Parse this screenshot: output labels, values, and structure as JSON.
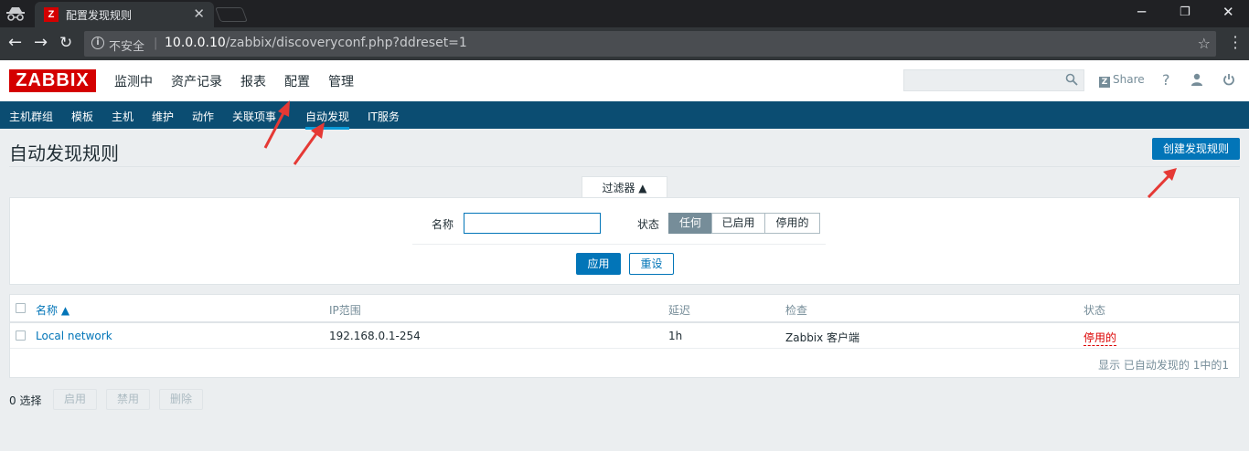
{
  "browser": {
    "tab_title": "配置发现规则",
    "tab_favicon": "Z",
    "security_label": "不安全",
    "url_host": "10.0.0.10",
    "url_path": "/zabbix/discoveryconf.php?ddreset=1"
  },
  "header": {
    "logo": "ZABBIX",
    "menu": [
      "监测中",
      "资产记录",
      "报表",
      "配置",
      "管理"
    ],
    "active_menu": "配置",
    "share_label": "Share",
    "help_label": "?"
  },
  "subnav": {
    "items": [
      "主机群组",
      "模板",
      "主机",
      "维护",
      "动作",
      "关联项事",
      "自动发现",
      "IT服务"
    ],
    "active": "自动发现"
  },
  "page": {
    "title": "自动发现规则",
    "create_button": "创建发现规则"
  },
  "filter": {
    "tab_label": "过滤器 ▲",
    "name_label": "名称",
    "name_value": "",
    "status_label": "状态",
    "status_options": [
      "任何",
      "已启用",
      "停用的"
    ],
    "status_selected": "任何",
    "apply_label": "应用",
    "reset_label": "重设"
  },
  "table": {
    "columns": [
      "名称 ▲",
      "IP范围",
      "延迟",
      "检查",
      "状态"
    ],
    "rows": [
      {
        "name": "Local network",
        "ip_range": "192.168.0.1-254",
        "delay": "1h",
        "checks": "Zabbix 客户端",
        "status": "停用的"
      }
    ],
    "summary": "显示 已自动发现的 1中的1"
  },
  "footer": {
    "selected": "0 选择",
    "enable_label": "启用",
    "disable_label": "禁用",
    "delete_label": "删除"
  },
  "colors": {
    "brand_red": "#d40000",
    "nav_blue": "#0b4d72",
    "accent_blue": "#0275b8",
    "status_red": "#dc0000",
    "annotation_red": "#e53935"
  }
}
